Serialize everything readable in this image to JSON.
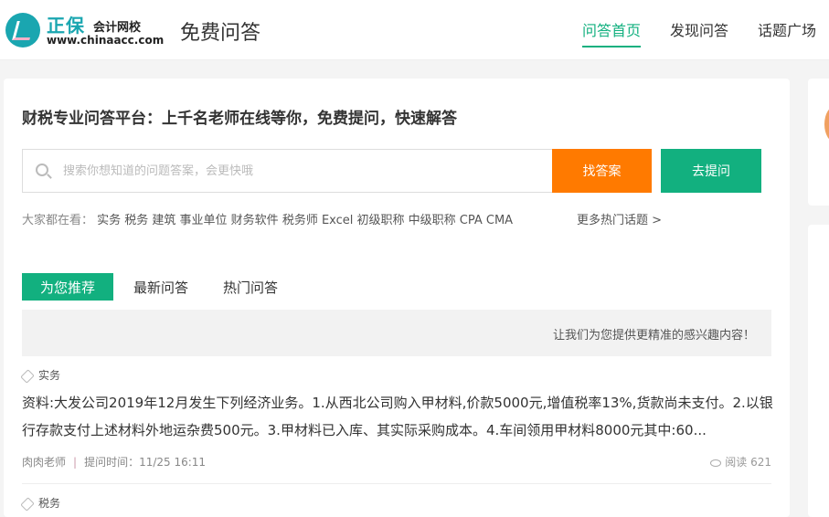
{
  "header": {
    "logo_big": "正保",
    "logo_small": "会计网校",
    "logo_url": "www.chinaacc.com",
    "site_title": "免费问答",
    "nav": [
      {
        "label": "问答首页",
        "active": true
      },
      {
        "label": "发现问答"
      },
      {
        "label": "话题广场"
      }
    ]
  },
  "main": {
    "headline": "财税专业问答平台：上千名老师在线等你，免费提问，快速解答",
    "search": {
      "placeholder": "搜索你想知道的问题答案，会更快哦",
      "value": ""
    },
    "find_button": "找答案",
    "ask_button": "去提问",
    "hot_label": "大家都在看：",
    "hot_topics": "实务 税务 建筑 事业单位 财务软件 税务师 Excel 初级职称 中级职称 CPA CMA",
    "more_topics": "更多热门话题 >",
    "tabs": [
      {
        "label": "为您推荐"
      },
      {
        "label": "最新问答"
      },
      {
        "label": "热门问答"
      }
    ],
    "banner": "让我们为您提供更精准的感兴趣内容！",
    "questions": [
      {
        "tag": "实务",
        "text": "资料:大发公司2019年12月发生下列经济业务。1.从西北公司购入甲材料,价款5000元,增值税率13%,货款尚未支付。2.以银行存款支付上述材料外地运杂费500元。3.甲材料已入库、其实际采购成本。4.车间领用甲材料8000元其中:60...",
        "author": "肉肉老师",
        "time": "提问时间：11/25 16:11",
        "views": "阅读 621"
      },
      {
        "tag": "税务"
      }
    ]
  },
  "colors": {
    "accent": "#12b07f",
    "orange": "#ff7a00"
  }
}
